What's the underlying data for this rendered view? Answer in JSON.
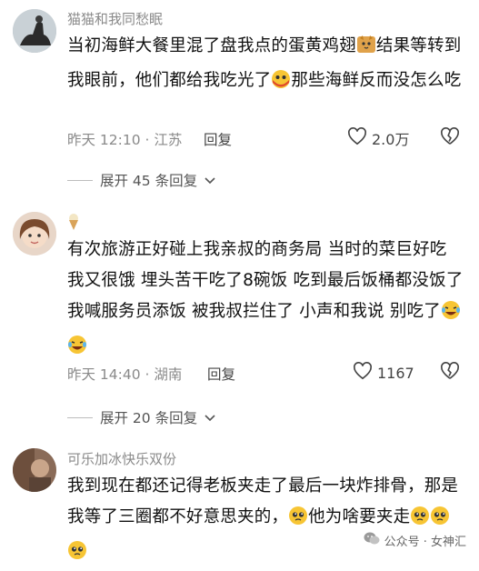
{
  "comments": [
    {
      "username": "猫猫和我同愁眠",
      "text_parts": [
        "当初海鲜大餐里混了盘我点的蛋黄鸡翅",
        "结果等转到我眼前，他们都给我吃光了",
        "那些海鲜反而没怎么吃"
      ],
      "time": "昨天 12:10 · 江苏",
      "reply_label": "回复",
      "likes": "2.0万",
      "expand_label": "展开 45 条回复"
    },
    {
      "username": "",
      "username_icon": "ice-cream-icon",
      "text_parts": [
        "有次旅游正好碰上我亲叔的商务局 当时的菜巨好吃 我又很饿 埋头苦干吃了8碗饭 吃到最后饭桶都没饭了 我喊服务员添饭 被我叔拦住了 小声和我说 别吃了"
      ],
      "time": "昨天 14:40 · 湖南",
      "reply_label": "回复",
      "likes": "1167",
      "expand_label": "展开 20 条回复"
    },
    {
      "username": "可乐加冰快乐双份",
      "text_parts": [
        "我到现在都还记得老板夹走了最后一块炸排骨，那是我等了三圈都不好意思夹的，",
        "他为啥要夹走"
      ]
    }
  ],
  "watermark": "公众号 · 女神汇",
  "colors": {
    "meta": "#8a8a8a",
    "text": "#111111",
    "line": "#bdbdbd"
  }
}
